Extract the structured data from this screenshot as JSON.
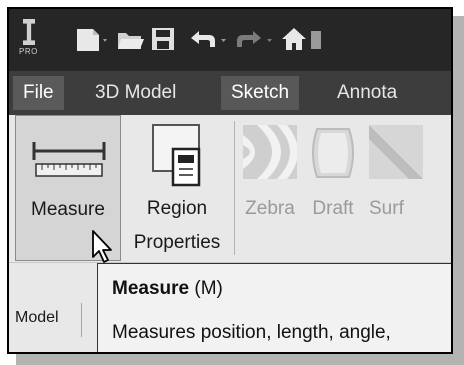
{
  "app": {
    "logo_label": "PRO"
  },
  "quick_access": {
    "icons": [
      "app-logo",
      "new-file-icon",
      "open-folder-icon",
      "save-icon",
      "undo-icon",
      "redo-icon",
      "home-icon"
    ]
  },
  "tabs": [
    {
      "label": "File",
      "state": "selected"
    },
    {
      "label": "3D Model",
      "state": "normal"
    },
    {
      "label": "Sketch",
      "state": "highlighted"
    },
    {
      "label": "Annota",
      "state": "normal"
    }
  ],
  "ribbon": {
    "buttons": [
      {
        "label": "Measure",
        "icon": "ruler-icon",
        "enabled": true
      },
      {
        "label_line1": "Region",
        "label_line2": "Properties",
        "icon": "region-properties-icon",
        "enabled": true
      },
      {
        "label": "Zebra",
        "icon": "zebra-icon",
        "enabled": false
      },
      {
        "label": "Draft",
        "icon": "draft-icon",
        "enabled": false
      },
      {
        "label": "Surf",
        "icon": "surface-icon",
        "enabled": false
      }
    ],
    "panel_label": "Model"
  },
  "tooltip": {
    "command": "Measure",
    "shortcut": "(M)",
    "description": "Measures position, length, angle,"
  },
  "colors": {
    "qat_bg": "#262626",
    "tab_bg": "#3d3d3d",
    "ribbon_bg": "#e8e8e8",
    "tooltip_bg": "#f2f2f2",
    "shadow": "#b3b3b3"
  }
}
